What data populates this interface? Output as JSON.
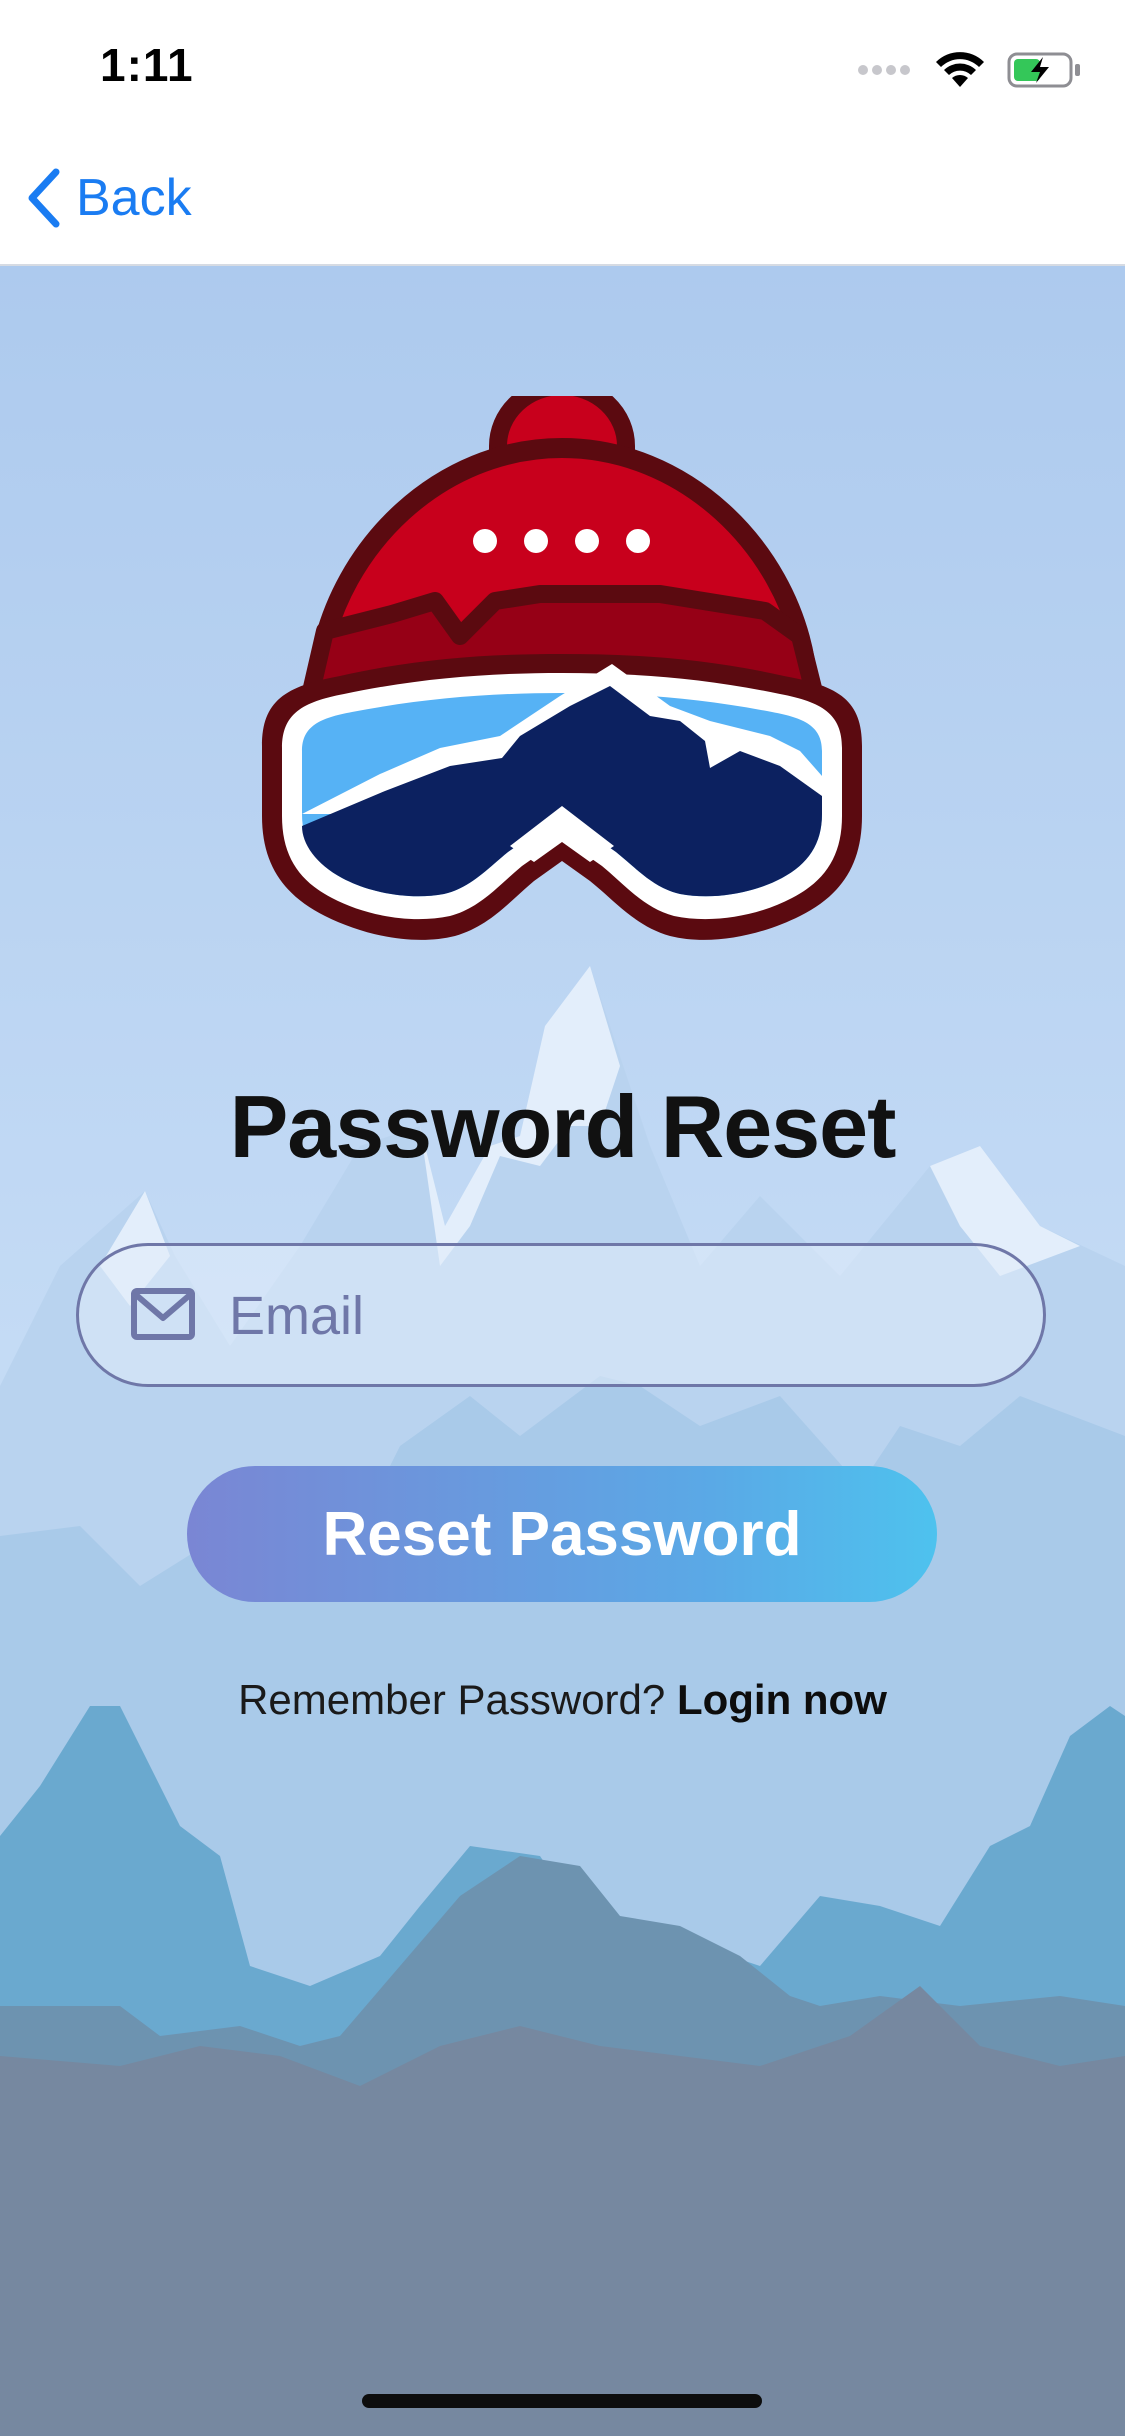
{
  "status_bar": {
    "time": "1:11"
  },
  "nav": {
    "back_label": "Back"
  },
  "page": {
    "title": "Password Reset"
  },
  "email": {
    "placeholder": "Email",
    "value": ""
  },
  "actions": {
    "reset_label": "Reset Password"
  },
  "login_prompt": {
    "text": "Remember Password?",
    "link": "Login now"
  },
  "colors": {
    "accent_blue": "#1a7cf2",
    "button_gradient_start": "#7a86d4",
    "button_gradient_end": "#4ec2ee",
    "field_border": "#6f77a8",
    "hat_red": "#c8001c",
    "hat_outline": "#5b0a10",
    "goggle_sky": "#56b2f5",
    "goggle_mountain": "#0c2160"
  },
  "icons": {
    "back": "chevron-left-icon",
    "email": "envelope-icon",
    "signal": "signal-icon",
    "wifi": "wifi-icon",
    "battery": "battery-charging-icon",
    "logo": "beanie-goggles-logo"
  }
}
